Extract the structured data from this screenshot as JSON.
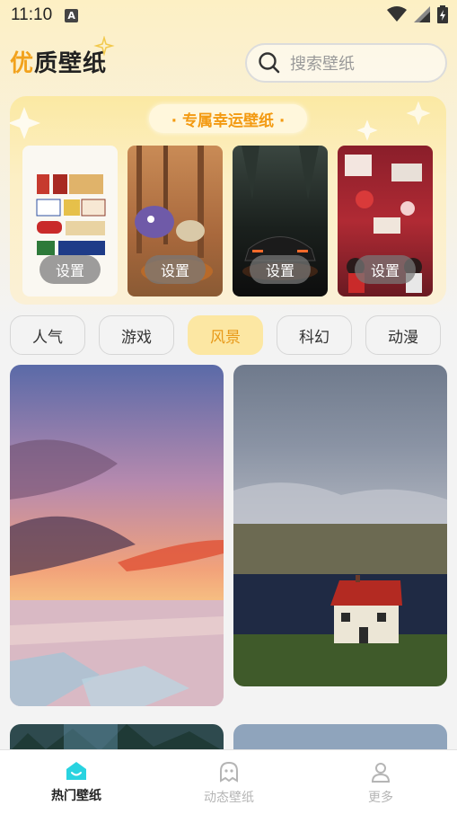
{
  "status_bar": {
    "time": "11:10",
    "badge": "A"
  },
  "header": {
    "logo_first": "优",
    "logo_rest": "质壁纸",
    "search_placeholder": "搜索壁纸"
  },
  "lucky": {
    "title": "· 专属幸运壁纸 ·",
    "set_label": "设置",
    "cards": [
      {
        "name": "shop-signs"
      },
      {
        "name": "forest-illustration"
      },
      {
        "name": "sports-car"
      },
      {
        "name": "red-collage"
      }
    ]
  },
  "categories": {
    "items": [
      "人气",
      "游戏",
      "风景",
      "科幻",
      "动漫"
    ],
    "active": "风景"
  },
  "bottom_nav": {
    "items": [
      "热门壁纸",
      "动态壁纸",
      "更多"
    ],
    "active": "热门壁纸"
  },
  "colors": {
    "accent": "#f39a12",
    "active_chip_bg": "#fce7a3",
    "nav_active_icon": "#29d3e0"
  }
}
